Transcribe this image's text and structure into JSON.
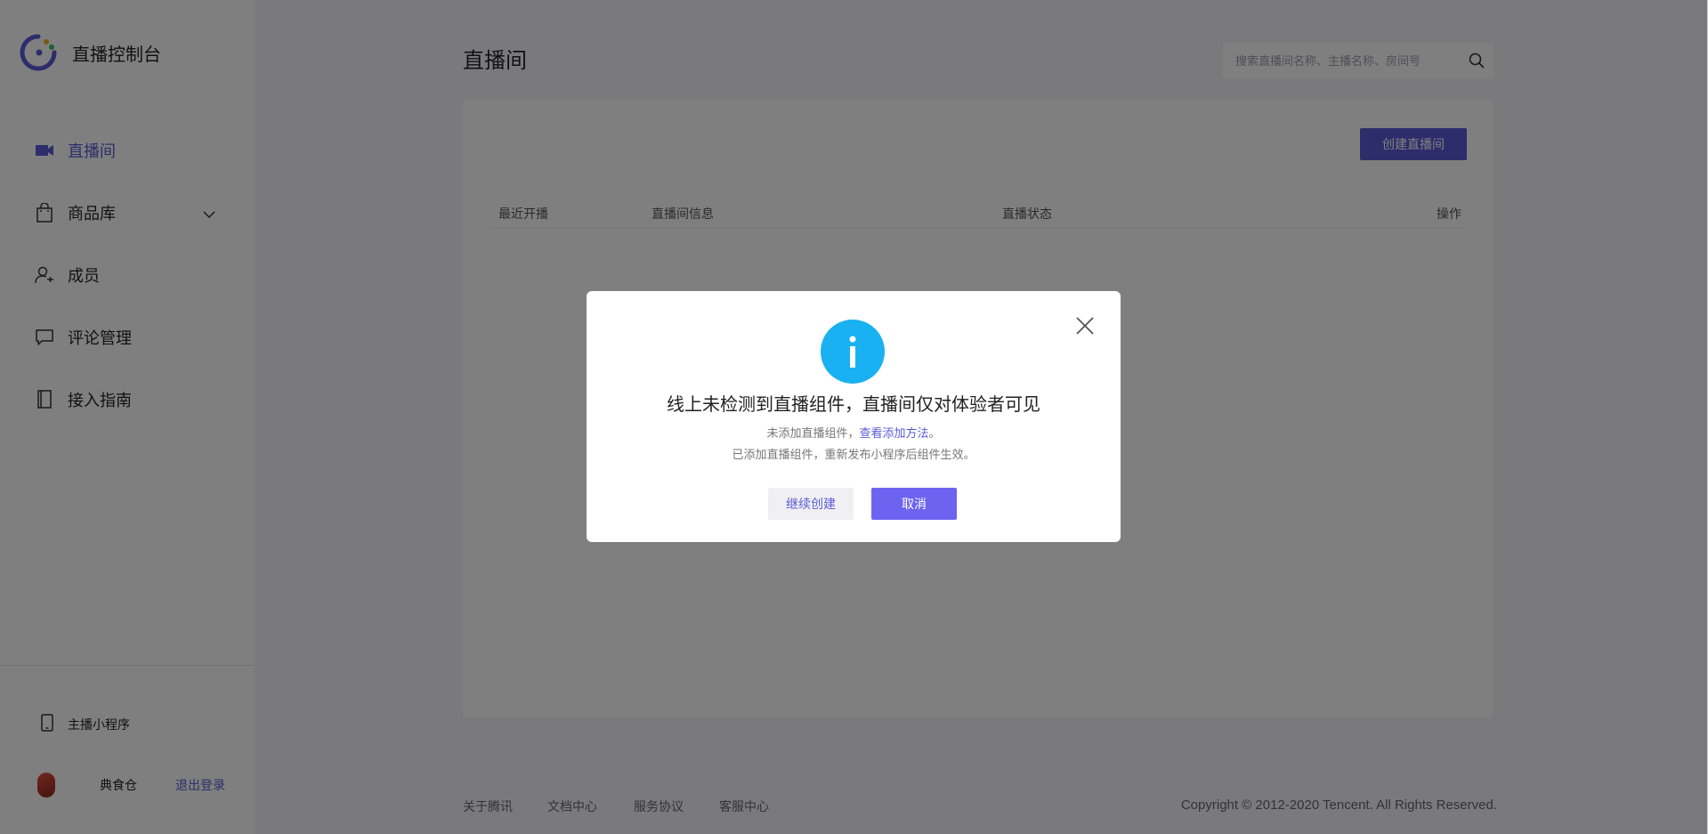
{
  "app": {
    "title": "直播控制台"
  },
  "sidebar": {
    "items": [
      {
        "label": "直播间",
        "icon": "video-camera-icon",
        "active": true
      },
      {
        "label": "商品库",
        "icon": "shopping-bag-icon",
        "expandable": true
      },
      {
        "label": "成员",
        "icon": "members-icon"
      },
      {
        "label": "评论管理",
        "icon": "comment-icon"
      },
      {
        "label": "接入指南",
        "icon": "book-icon"
      }
    ],
    "mini_program": "主播小程序",
    "user": {
      "name": "典食仓",
      "logout": "退出登录"
    }
  },
  "header": {
    "title": "直播间",
    "search": {
      "placeholder": "搜索直播间名称、主播名称、房间号",
      "value": ""
    }
  },
  "main": {
    "create_button": "创建直播间",
    "table": {
      "columns": [
        "最近开播",
        "直播间信息",
        "直播状态",
        "操作"
      ]
    }
  },
  "footer": {
    "links": [
      "关于腾讯",
      "文档中心",
      "服务协议",
      "客服中心"
    ],
    "copyright": "Copyright © 2012-2020 Tencent. All Rights Reserved."
  },
  "modal": {
    "icon": "info-icon",
    "title": "线上未检测到直播组件，直播间仅对体验者可见",
    "line1_prefix": "未添加直播组件，",
    "line1_link": "查看添加方法",
    "line1_suffix": "。",
    "line2": "已添加直播组件，重新发布小程序后组件生效。",
    "continue_label": "继续创建",
    "cancel_label": "取消"
  },
  "colors": {
    "accent": "#5b5bd6",
    "info": "#1ab1f3",
    "sidebar_bg": "#ffffff",
    "page_bg": "#f4f5f8"
  }
}
